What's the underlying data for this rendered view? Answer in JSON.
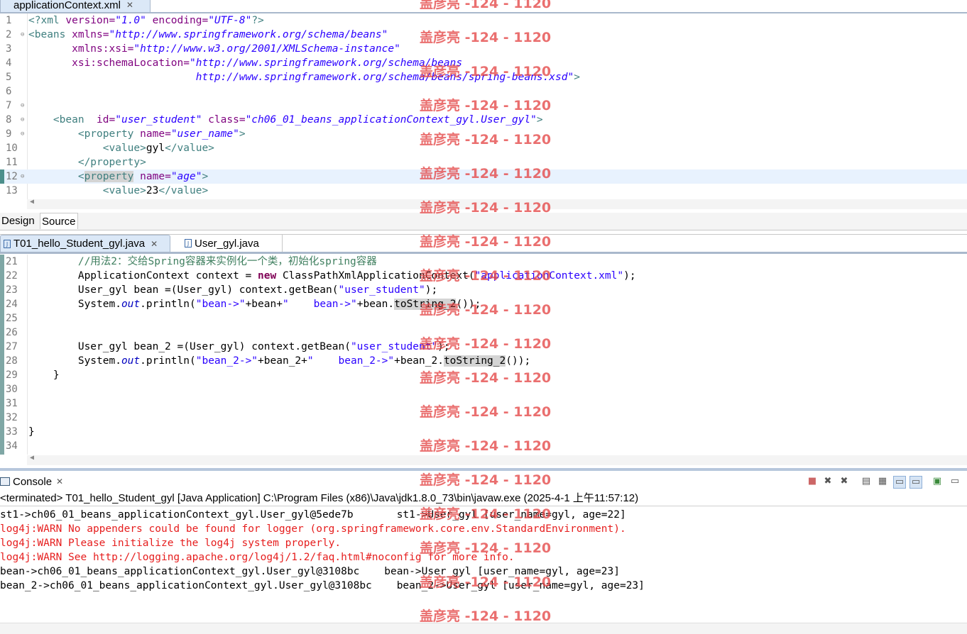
{
  "xml_editor": {
    "tab_title": "applicationContext.xml",
    "bottom_tabs": [
      "Design",
      "Source"
    ],
    "lines": [
      {
        "n": "1",
        "fold": "",
        "parts": [
          [
            "pi",
            "<?xml "
          ],
          [
            "attr",
            "version="
          ],
          [
            "str",
            "\"1.0\""
          ],
          [
            "attr",
            " encoding="
          ],
          [
            "str",
            "\"UTF-8\""
          ],
          [
            "pi",
            "?>"
          ]
        ]
      },
      {
        "n": "2",
        "fold": "⊖",
        "parts": [
          [
            "tag",
            "<beans "
          ],
          [
            "attr",
            "xmlns="
          ],
          [
            "str",
            "\"http://www.springframework.org/schema/beans\""
          ]
        ]
      },
      {
        "n": "3",
        "fold": "",
        "parts": [
          [
            "txt",
            "       "
          ],
          [
            "attr",
            "xmlns:xsi="
          ],
          [
            "str",
            "\"http://www.w3.org/2001/XMLSchema-instance\""
          ]
        ]
      },
      {
        "n": "4",
        "fold": "",
        "parts": [
          [
            "txt",
            "       "
          ],
          [
            "attr",
            "xsi:schemaLocation="
          ],
          [
            "str",
            "\"http://www.springframework.org/schema/beans"
          ]
        ]
      },
      {
        "n": "5",
        "fold": "",
        "parts": [
          [
            "txt",
            "                           "
          ],
          [
            "str",
            "http://www.springframework.org/schema/beans/spring-beans.xsd\""
          ],
          [
            "tag",
            ">"
          ]
        ]
      },
      {
        "n": "6",
        "fold": "",
        "parts": []
      },
      {
        "n": "7",
        "fold": "⊖",
        "parts": []
      },
      {
        "n": "8",
        "fold": "⊖",
        "parts": [
          [
            "txt",
            "    "
          ],
          [
            "tag",
            "<bean  "
          ],
          [
            "attr",
            "id="
          ],
          [
            "str",
            "\"user_student\""
          ],
          [
            "attr",
            " class="
          ],
          [
            "str",
            "\"ch06_01_beans_applicationContext_gyl.User_gyl\""
          ],
          [
            "tag",
            ">"
          ]
        ]
      },
      {
        "n": "9",
        "fold": "⊖",
        "parts": [
          [
            "txt",
            "        "
          ],
          [
            "tag",
            "<property "
          ],
          [
            "attr",
            "name="
          ],
          [
            "str",
            "\"user_name\""
          ],
          [
            "tag",
            ">"
          ]
        ]
      },
      {
        "n": "10",
        "fold": "",
        "parts": [
          [
            "txt",
            "            "
          ],
          [
            "tag",
            "<value>"
          ],
          [
            "txt",
            "gyl"
          ],
          [
            "tag",
            "</value>"
          ]
        ]
      },
      {
        "n": "11",
        "fold": "",
        "parts": [
          [
            "txt",
            "        "
          ],
          [
            "tag",
            "</property>"
          ]
        ]
      },
      {
        "n": "12",
        "fold": "⊖",
        "parts": [
          [
            "txt",
            "        "
          ],
          [
            "tag",
            "<"
          ],
          [
            "tagocc",
            "property"
          ],
          [
            "tag",
            " "
          ],
          [
            "attr",
            "name="
          ],
          [
            "str",
            "\"age\""
          ],
          [
            "tag",
            ">"
          ]
        ],
        "highlight": true,
        "marker": true
      },
      {
        "n": "13",
        "fold": "",
        "parts": [
          [
            "txt",
            "            "
          ],
          [
            "tag",
            "<value>"
          ],
          [
            "txt",
            "23"
          ],
          [
            "tag",
            "</value>"
          ]
        ]
      }
    ]
  },
  "java_editor": {
    "tabs": [
      {
        "label": "T01_hello_Student_gyl.java",
        "active": true
      },
      {
        "label": "User_gyl.java",
        "active": false
      }
    ],
    "lines": [
      {
        "n": "21",
        "parts": [
          [
            "txt",
            "        "
          ],
          [
            "cm",
            "//用法2：交给Spring容器来实例化一个类，初始化spring容器"
          ]
        ]
      },
      {
        "n": "22",
        "parts": [
          [
            "txt",
            "        ApplicationContext context = "
          ],
          [
            "kw",
            "new"
          ],
          [
            "txt",
            " ClassPathXmlApplicationContext("
          ],
          [
            "jstr",
            "\"applicationContext.xml\""
          ],
          [
            "txt",
            ");"
          ]
        ]
      },
      {
        "n": "23",
        "parts": [
          [
            "txt",
            "        User_gyl bean =(User_gyl) context.getBean("
          ],
          [
            "jstr",
            "\"user_student\""
          ],
          [
            "txt",
            ");"
          ]
        ]
      },
      {
        "n": "24",
        "parts": [
          [
            "txt",
            "        System."
          ],
          [
            "fld",
            "out"
          ],
          [
            "txt",
            ".println("
          ],
          [
            "jstr",
            "\"bean->\""
          ],
          [
            "txt",
            "+bean+"
          ],
          [
            "jstr",
            "\"    bean->\""
          ],
          [
            "txt",
            "+bean."
          ],
          [
            "occ",
            "toString_2"
          ],
          [
            "txt",
            "());"
          ]
        ]
      },
      {
        "n": "25",
        "parts": []
      },
      {
        "n": "26",
        "parts": []
      },
      {
        "n": "27",
        "parts": [
          [
            "txt",
            "        User_gyl bean_2 =(User_gyl) context.getBean("
          ],
          [
            "jstr",
            "\"user_student\""
          ],
          [
            "txt",
            ");"
          ]
        ]
      },
      {
        "n": "28",
        "parts": [
          [
            "txt",
            "        System."
          ],
          [
            "fld",
            "out"
          ],
          [
            "txt",
            ".println("
          ],
          [
            "jstr",
            "\"bean_2->\""
          ],
          [
            "txt",
            "+bean_2+"
          ],
          [
            "jstr",
            "\"    bean_2->\""
          ],
          [
            "txt",
            "+bean_2."
          ],
          [
            "occ",
            "toString_2"
          ],
          [
            "txt",
            "());"
          ]
        ]
      },
      {
        "n": "29",
        "parts": [
          [
            "txt",
            "    }"
          ]
        ]
      },
      {
        "n": "30",
        "parts": []
      },
      {
        "n": "31",
        "parts": []
      },
      {
        "n": "32",
        "parts": []
      },
      {
        "n": "33",
        "parts": [
          [
            "txt",
            "}"
          ]
        ]
      },
      {
        "n": "34",
        "parts": []
      }
    ]
  },
  "console": {
    "title": "Console",
    "status": "<terminated> T01_hello_Student_gyl [Java Application] C:\\Program Files (x86)\\Java\\jdk1.8.0_73\\bin\\javaw.exe (2025-4-1 上午11:57:12)",
    "lines": [
      {
        "text": "st1->ch06_01_beans_applicationContext_gyl.User_gyl@5ede7b       st1->User_gyl [user_name=gyl, age=22]",
        "type": "out"
      },
      {
        "text": "log4j:WARN No appenders could be found for logger (org.springframework.core.env.StandardEnvironment).",
        "type": "err"
      },
      {
        "text": "log4j:WARN Please initialize the log4j system properly.",
        "type": "err"
      },
      {
        "text": "log4j:WARN See http://logging.apache.org/log4j/1.2/faq.html#noconfig for more info.",
        "type": "err"
      },
      {
        "text": "bean->ch06_01_beans_applicationContext_gyl.User_gyl@3108bc    bean->User_gyl [user_name=gyl, age=23]",
        "type": "out"
      },
      {
        "text": "bean_2->ch06_01_beans_applicationContext_gyl.User_gyl@3108bc    bean_2->User_gyl [user_name=gyl, age=23]",
        "type": "out"
      }
    ],
    "toolbar_icons": [
      "terminate-icon",
      "remove-launch-icon",
      "remove-all-launches-icon",
      "clear-console-icon",
      "scroll-lock-icon",
      "show-stdout-icon",
      "show-stderr-icon",
      "pin-console-icon",
      "display-console-icon"
    ]
  },
  "watermark": {
    "text": "盖彦亮 -124 - 1120",
    "count": 19
  }
}
